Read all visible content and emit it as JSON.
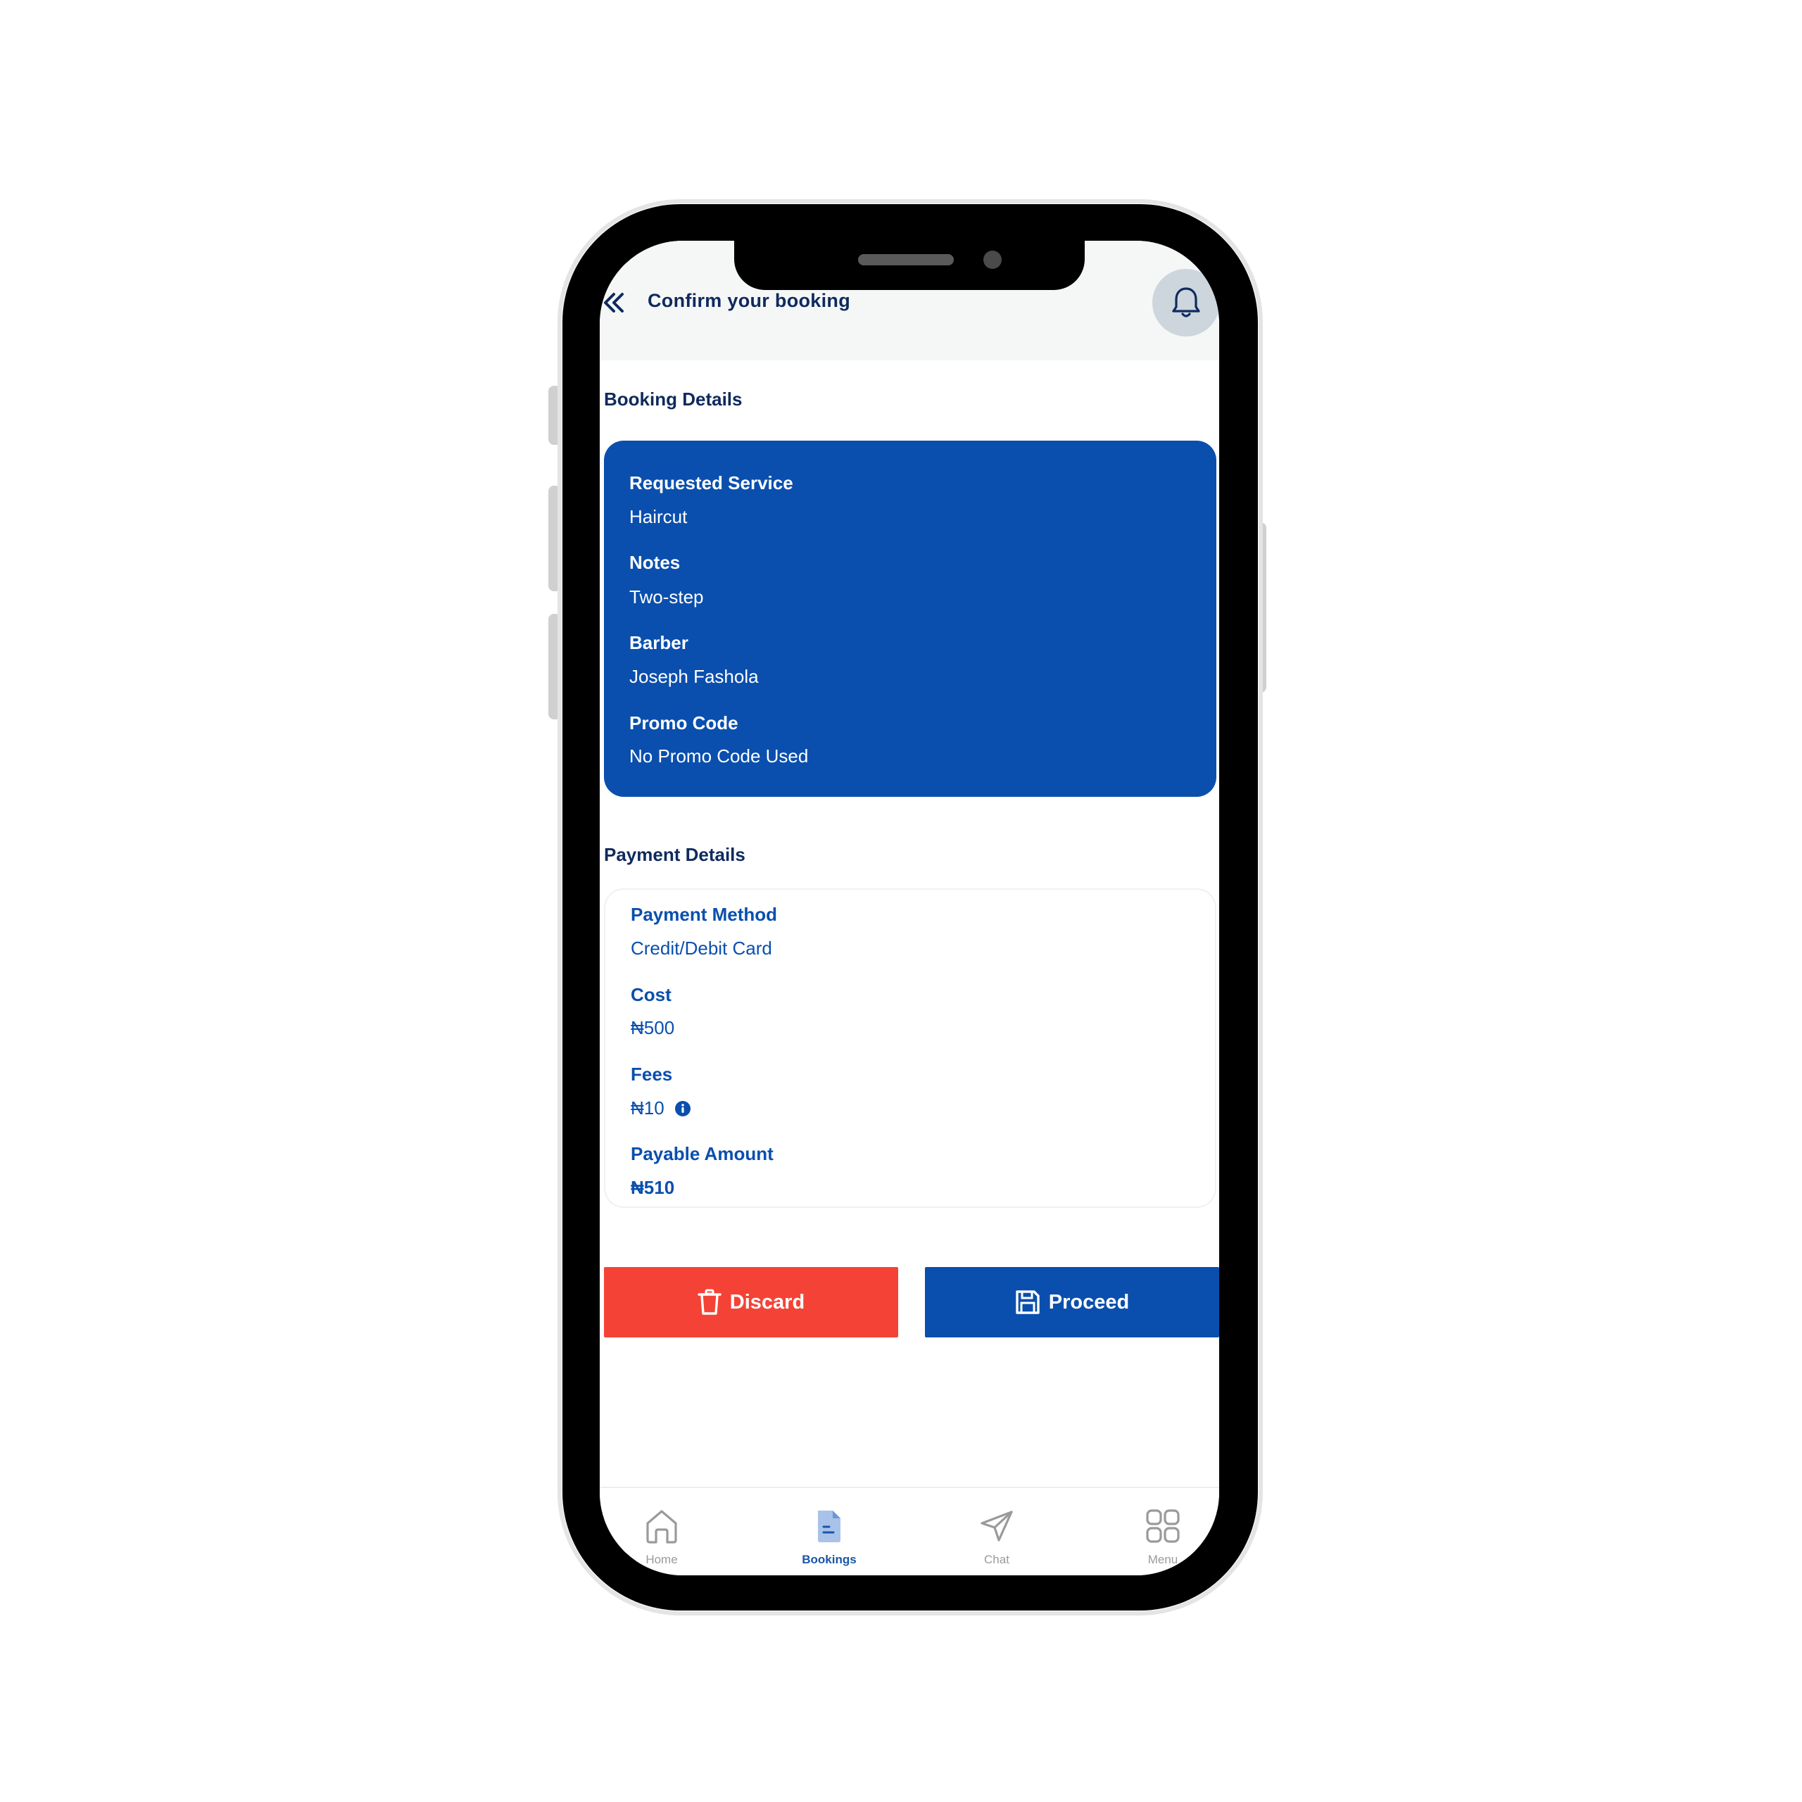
{
  "header": {
    "title": "Confirm your booking"
  },
  "booking": {
    "section_title": "Booking Details",
    "fields": [
      {
        "label": "Requested Service",
        "value": "Haircut"
      },
      {
        "label": "Notes",
        "value": "Two-step"
      },
      {
        "label": "Barber",
        "value": "Joseph Fashola"
      },
      {
        "label": "Promo Code",
        "value": "No Promo Code Used"
      }
    ]
  },
  "payment": {
    "section_title": "Payment Details",
    "fields": [
      {
        "label": "Payment Method",
        "value": "Credit/Debit Card"
      },
      {
        "label": "Cost",
        "value": "₦500"
      },
      {
        "label": "Fees",
        "value": "₦10"
      },
      {
        "label": "Payable Amount",
        "value": "₦510"
      }
    ]
  },
  "actions": {
    "discard_label": "Discard",
    "proceed_label": "Proceed"
  },
  "tabs": [
    {
      "label": "Home",
      "icon": "home-icon",
      "active": false
    },
    {
      "label": "Bookings",
      "icon": "document-icon",
      "active": true
    },
    {
      "label": "Chat",
      "icon": "send-icon",
      "active": false
    },
    {
      "label": "Menu",
      "icon": "grid-icon",
      "active": false
    }
  ],
  "colors": {
    "primary": "#0a4fad",
    "danger": "#f44336",
    "title_text": "#0f2a5c",
    "bell_bg": "#cdd5dd",
    "inactive_tab": "#9a9a9a",
    "active_tab": "#1a56a8"
  }
}
